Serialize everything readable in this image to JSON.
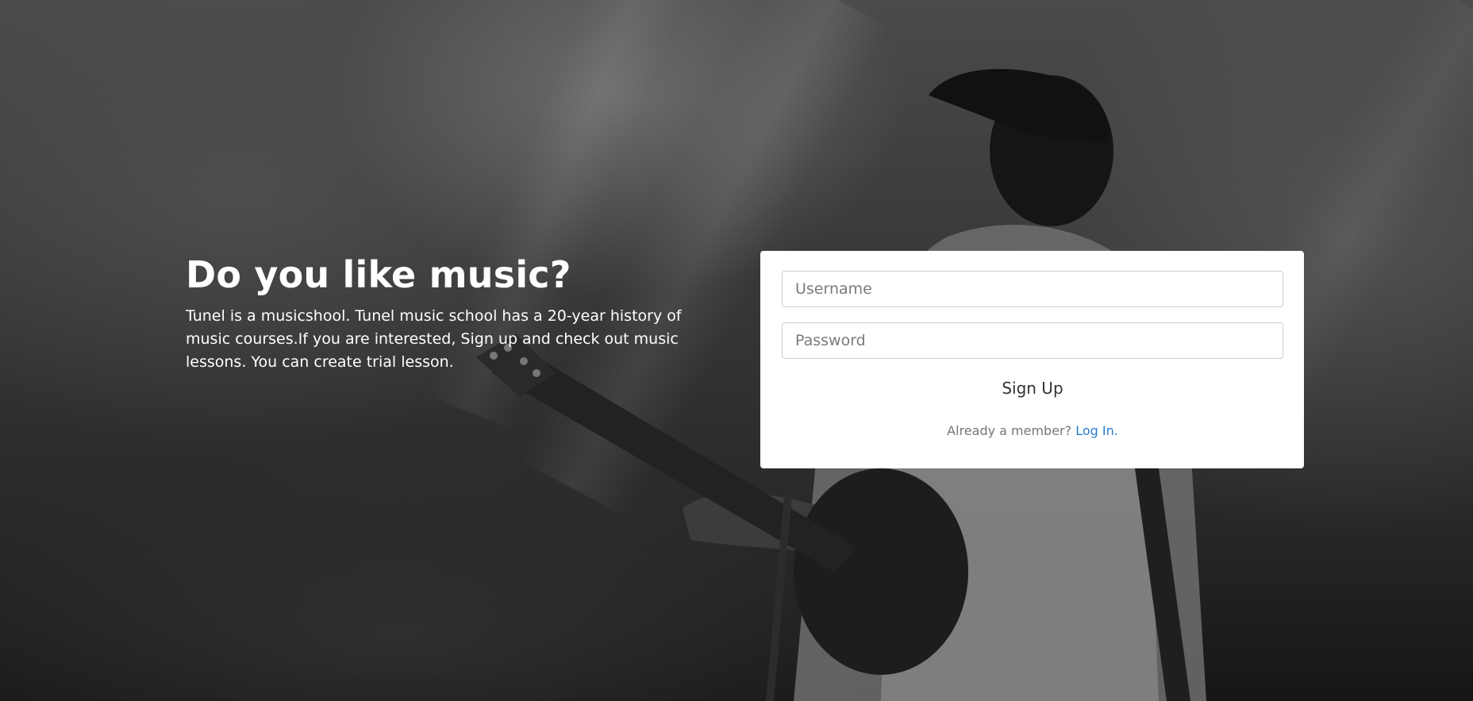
{
  "hero": {
    "title": "Do you like music?",
    "description": "Tunel is a musicshool. Tunel music school has a 20-year history of music courses.If you are interested, Sign up and check out music lessons. You can create trial lesson."
  },
  "form": {
    "username_placeholder": "Username",
    "password_placeholder": "Password",
    "signup_label": "Sign Up",
    "member_text": "Already a member?",
    "login_link": "Log In."
  },
  "colors": {
    "link": "#2a7ccf",
    "card_bg": "#ffffff",
    "hero_text": "#ffffff"
  },
  "background": {
    "icon": "concert-guitarist-photo"
  }
}
